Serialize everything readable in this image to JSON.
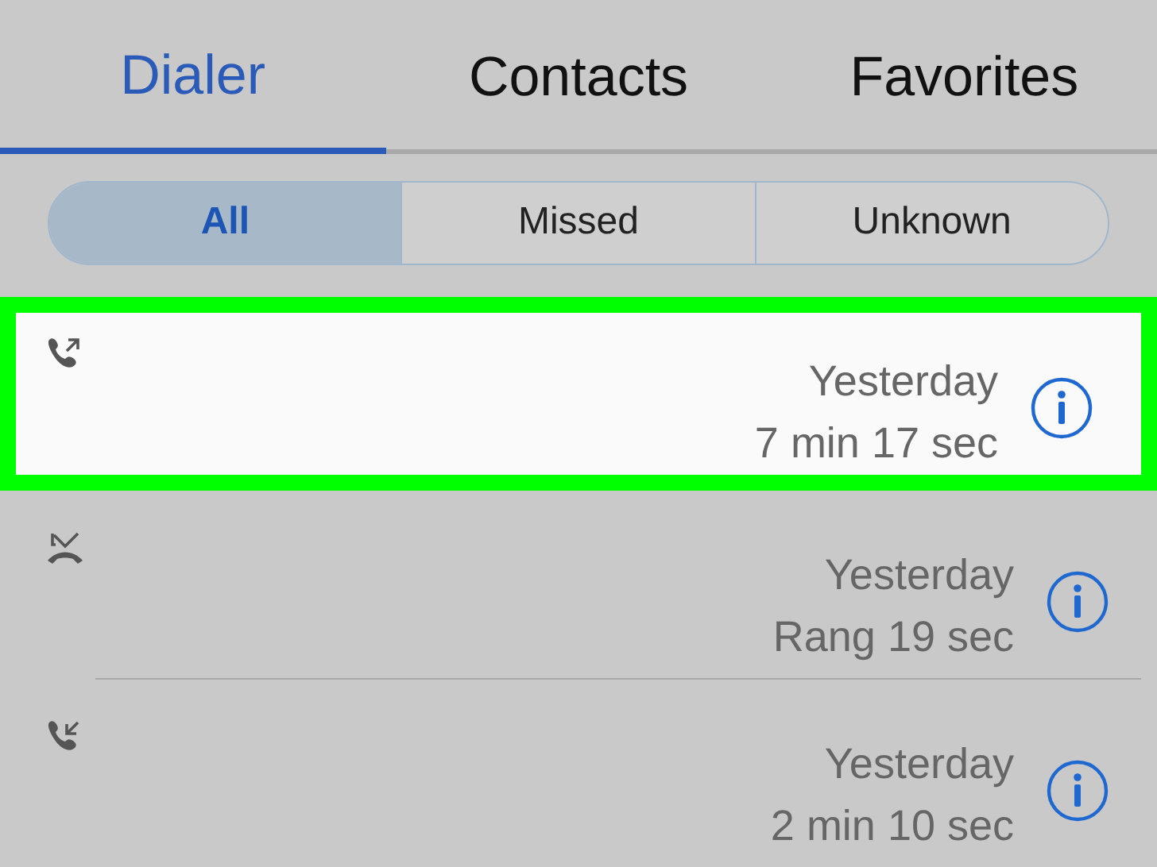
{
  "tabs": [
    {
      "label": "Dialer",
      "selected": true
    },
    {
      "label": "Contacts",
      "selected": false
    },
    {
      "label": "Favorites",
      "selected": false
    }
  ],
  "filters": [
    {
      "label": "All",
      "selected": true
    },
    {
      "label": "Missed",
      "selected": false
    },
    {
      "label": "Unknown",
      "selected": false
    }
  ],
  "calls": [
    {
      "kind": "outgoing",
      "highlighted": true,
      "date": "Yesterday",
      "duration": "7 min 17 sec"
    },
    {
      "kind": "rejected",
      "highlighted": false,
      "date": "Yesterday",
      "duration": "Rang 19 sec"
    },
    {
      "kind": "incoming",
      "highlighted": false,
      "date": "Yesterday",
      "duration": "2 min 10 sec"
    }
  ]
}
